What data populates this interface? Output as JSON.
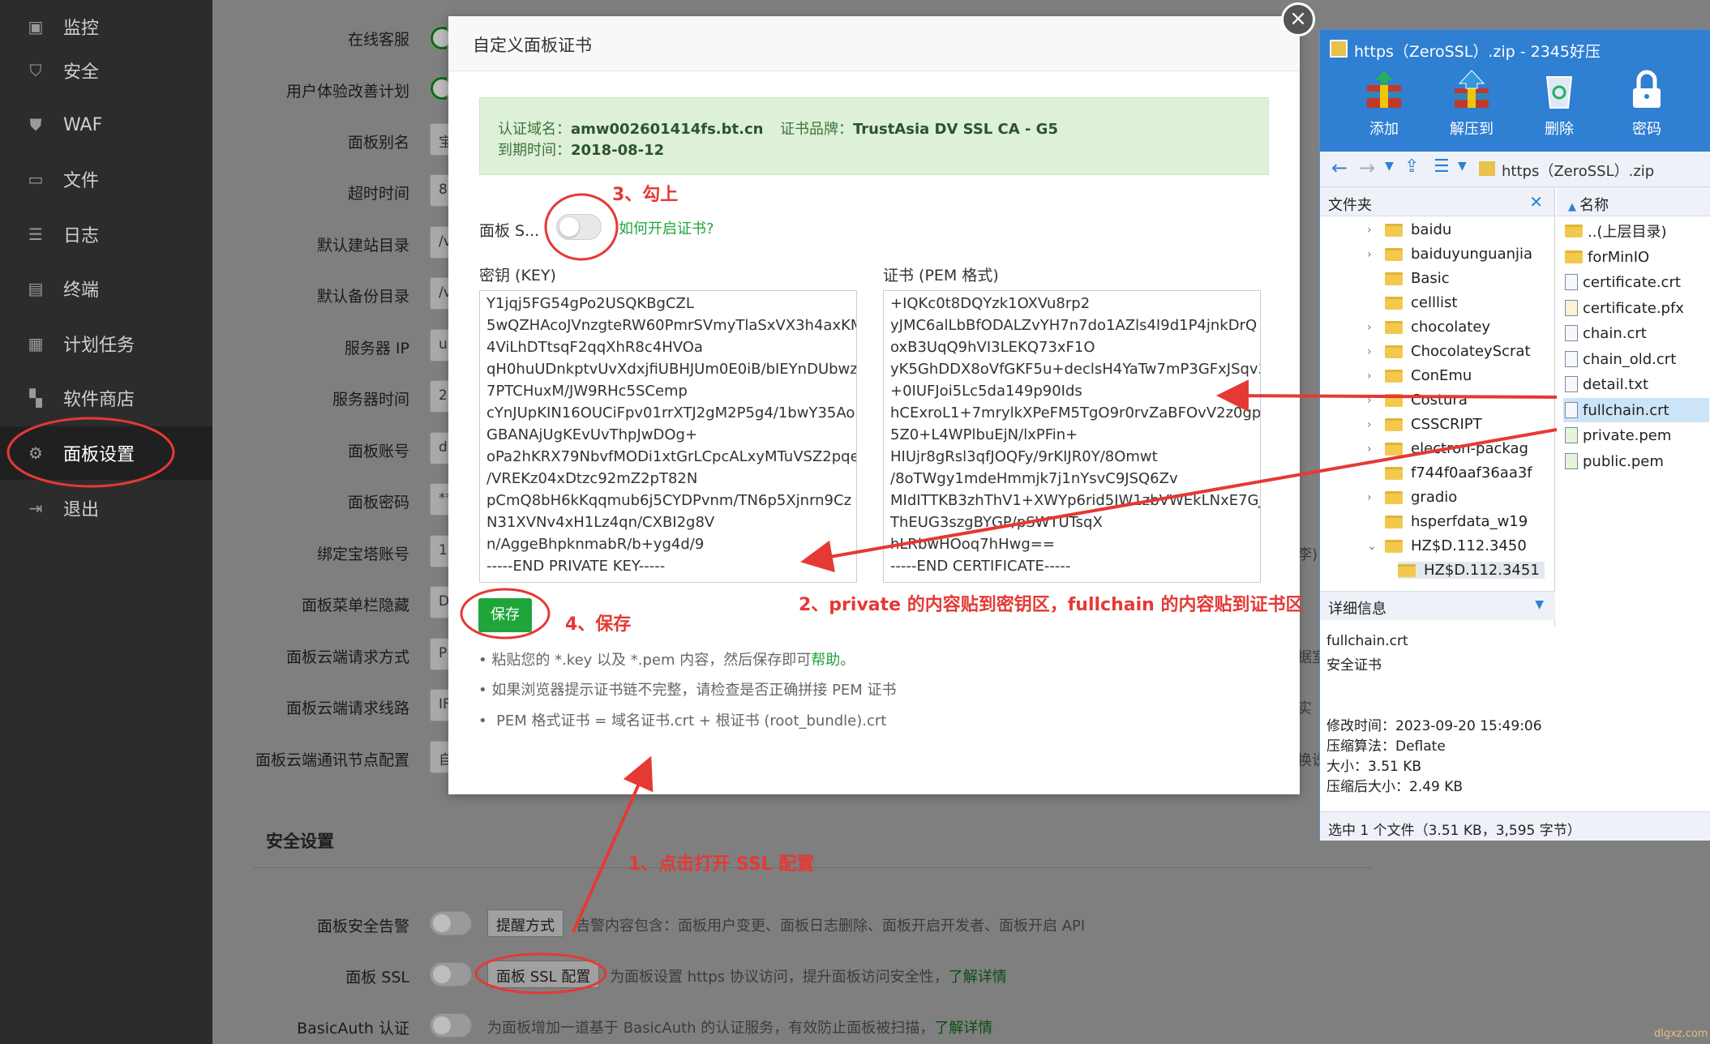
{
  "sidebar": {
    "items": [
      {
        "label": "监控",
        "icon": "monitor-icon"
      },
      {
        "label": "安全",
        "icon": "shield-icon"
      },
      {
        "label": "WAF",
        "icon": "waf-shield-icon"
      },
      {
        "label": "文件",
        "icon": "folder-icon"
      },
      {
        "label": "日志",
        "icon": "log-icon"
      },
      {
        "label": "终端",
        "icon": "terminal-icon"
      },
      {
        "label": "计划任务",
        "icon": "calendar-icon"
      },
      {
        "label": "软件商店",
        "icon": "grid-icon"
      },
      {
        "label": "面板设置",
        "icon": "gear-icon"
      },
      {
        "label": "退出",
        "icon": "logout-icon"
      }
    ]
  },
  "settings": {
    "rows": [
      {
        "label": "在线客服",
        "value": ""
      },
      {
        "label": "用户体验改善计划",
        "value": ""
      },
      {
        "label": "面板别名",
        "value": "宝"
      },
      {
        "label": "超时时间",
        "value": "8"
      },
      {
        "label": "默认建站目录",
        "value": "/v"
      },
      {
        "label": "默认备份目录",
        "value": "/v"
      },
      {
        "label": "服务器 IP",
        "value": "u"
      },
      {
        "label": "服务器时间",
        "value": "2"
      },
      {
        "label": "面板账号",
        "value": "d"
      },
      {
        "label": "面板密码",
        "value": "**"
      },
      {
        "label": "绑定宝塔账号",
        "value": "1"
      },
      {
        "label": "面板菜单栏隐藏",
        "value": "D"
      },
      {
        "label": "面板云端请求方式",
        "value": "P"
      },
      {
        "label": "面板云端请求线路",
        "value": "IF"
      },
      {
        "label": "面板云端通讯节点配置",
        "value": "自"
      }
    ],
    "right_fragments": [
      "李)",
      "据室",
      "实",
      "换说"
    ],
    "security_title": "安全设置",
    "alert": {
      "label": "面板安全告警",
      "button": "提醒方式",
      "desc": "告警内容包含：面板用户变更、面板日志删除、面板开启开发者、面板开启 API"
    },
    "ssl": {
      "label": "面板 SSL",
      "button": "面板 SSL 配置",
      "desc": "为面板设置 https 协议访问，提升面板访问安全性，",
      "link": "了解详情"
    },
    "basicauth": {
      "label": "BasicAuth 认证",
      "desc": "为面板增加一道基于 BasicAuth 的认证服务，有效防止面板被扫描，",
      "link": "了解详情"
    }
  },
  "modal": {
    "title": "自定义面板证书",
    "close": "×",
    "cert_info": {
      "domain_label": "认证域名：",
      "domain": "amw002601414fs.bt.cn",
      "brand_label": "证书品牌：",
      "brand": "TrustAsia DV SSL CA - G5",
      "expire_label": "到期时间：",
      "expire": "2018-08-12"
    },
    "panel_ssl_label": "面板 S...",
    "how_link": "如何开启证书?",
    "key_label": "密钥 (KEY)",
    "cert_label": "证书 (PEM 格式)",
    "key_text": "Y1jqj5FG54gPo2USQKBgCZL\n5wQZHAcoJVnzgteRW60PmrSVmyTlaSxVX3h4axKM\n4ViLhDTtsqF2qqXhR8c4HVOa\nqH0huUDnkptvUvXdxjfiUBHJUm0E0iB/bIEYnDUbwzl\n7PTCHuxM/JW9RHc5SCemp\ncYnJUpKIN16OUCiFpv01rrXTJ2gM2P5g4/1bwY35Ao\nGBANAjUgKEvUvThpJwDOg+\noPa2hKRX79NbvfMODi1xtGrLCpcALxyMTuVSZ2pqe\n/VREKz04xDtzc92mZ2pT82N\npCmQ8bH6kKqqmub6j5CYDPvnm/TN6p5Xjnrn9Cz\nN31XVNv4xH1Lz4qn/CXBI2g8V\nn/AggeBhpknmabR/b+yg4d/9\n-----END PRIVATE KEY-----",
    "cert_text": "+IQKc0t8DQYzk1OXVu8rp2\nyJMC6alLbBfODALZvYH7n7do1AZls4I9d1P4jnkDrQ\noxB3UqQ9hVI3LEKQ73xF1O\nyK5GhDDX8oVfGKF5u+declsH4YaTw7mP3GFxJSqv3\n+0IUFJoi5Lc5da149p90Ids\nhCExroL1+7mrylkXPeFM5TgO9r0rvZaBFOvV2z0gp3\n5Z0+L4WPlbuEjN/lxPFin+\nHIUjr8gRsl3qfJOQFy/9rKIJR0Y/8Omwt\n/8oTWgy1mdeHmmjk7j1nYsvC9JSQ6Zv\nMIdITTKB3zhThV1+XWYp6rid5JW1zbVWEkLNxE7GJ\nThEUG3szgBYGP/pSWTUTsqX\nhLRbwHOoq7hHwg==\n-----END CERTIFICATE-----",
    "save_button": "保存",
    "tips": [
      {
        "text": "粘贴您的 *.key 以及 *.pem 内容，然后保存即可",
        "link": "帮助",
        "suffix": "。"
      },
      {
        "text": "如果浏览器提示证书链不完整，请检查是否正确拼接 PEM 证书",
        "link": "",
        "suffix": ""
      },
      {
        "text": "PEM 格式证书 = 域名证书.crt + 根证书 (root_bundle).crt",
        "link": "",
        "suffix": ""
      }
    ]
  },
  "annotations": {
    "step1": "1、点击打开 SSL 配置",
    "step2": "2、private 的内容贴到密钥区，fullchain 的内容贴到证书区",
    "step3": "3、勾上",
    "step4": "4、保存",
    "color": "#e53935"
  },
  "zip": {
    "title": "https（ZeroSSL）.zip - 2345好压",
    "tools": [
      {
        "label": "添加",
        "icon": "add-archive-icon"
      },
      {
        "label": "解压到",
        "icon": "extract-icon"
      },
      {
        "label": "删除",
        "icon": "recycle-bin-icon"
      },
      {
        "label": "密码",
        "icon": "lock-icon"
      }
    ],
    "path": "https（ZeroSSL）.zip",
    "folders_header": "文件夹",
    "name_header": "名称",
    "folders": [
      "baidu",
      "baiduyunguanjia",
      "Basic",
      "celllist",
      "chocolatey",
      "ChocolateyScrat",
      "ConEmu",
      "Costura",
      "CSSCRIPT",
      "electron-packag",
      "f744f0aaf36aa3f",
      "gradio",
      "hsperfdata_w19",
      "HZ$D.112.3450",
      "HZ$D.112.3451"
    ],
    "files": [
      "..(上层目录)",
      "forMinIO",
      "certificate.crt",
      "certificate.pfx",
      "chain.crt",
      "chain_old.crt",
      "detail.txt",
      "fullchain.crt",
      "private.pem",
      "public.pem"
    ],
    "details_header": "详细信息",
    "details": {
      "name": "fullchain.crt",
      "type": "安全证书",
      "modified": "修改时间：2023-09-20 15:49:06",
      "method": "压缩算法：Deflate",
      "size": "大小：3.51 KB",
      "packed": "压缩后大小：2.49 KB"
    },
    "status": "选中 1 个文件（3.51 KB，3,595 字节）"
  },
  "watermark": "dlgxz.com"
}
